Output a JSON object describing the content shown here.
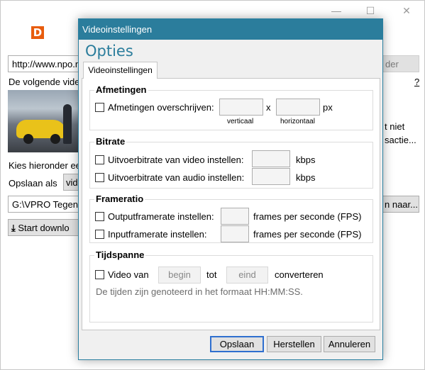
{
  "main": {
    "logo_letter": "D",
    "url_value": "http://www.npo.n",
    "right_button_partial": "der",
    "help_link": "?",
    "line_following": "De volgende vide",
    "right_text_1": "t niet",
    "right_text_2": "sactie...",
    "choose_text": "Kies hieronder ee",
    "save_as_label": "Opslaan als",
    "combo_partial": "vid",
    "path_value": "G:\\VPRO Tegenli",
    "browse_partial": "n naar...",
    "start_button": "Start downlo",
    "controls": {
      "minimize": "—",
      "maximize": "☐",
      "close": "✕"
    }
  },
  "dialog": {
    "title": "Videoinstellingen",
    "heading": "Opties",
    "tab_label": "Videoinstellingen",
    "dimensions": {
      "title": "Afmetingen",
      "override_label": "Afmetingen overschrijven:",
      "separator": "x",
      "unit": "px",
      "vertical_label": "verticaal",
      "horizontal_label": "horizontaal"
    },
    "bitrate": {
      "title": "Bitrate",
      "video_label": "Uitvoerbitrate van video instellen:",
      "audio_label": "Uitvoerbitrate van audio instellen:",
      "unit": "kbps"
    },
    "framerate": {
      "title": "Frameratio",
      "output_label": "Outputframerate instellen:",
      "input_label": "Inputframerate instellen:",
      "unit": "frames per seconde (FPS)"
    },
    "timespan": {
      "title": "Tijdspanne",
      "video_from_label": "Video van",
      "begin_placeholder": "begin",
      "to_label": "tot",
      "end_placeholder": "eind",
      "convert_label": "converteren",
      "note": "De tijden zijn genoteerd in het formaat HH:MM:SS."
    },
    "buttons": {
      "save": "Opslaan",
      "reset": "Herstellen",
      "cancel": "Annuleren"
    }
  }
}
